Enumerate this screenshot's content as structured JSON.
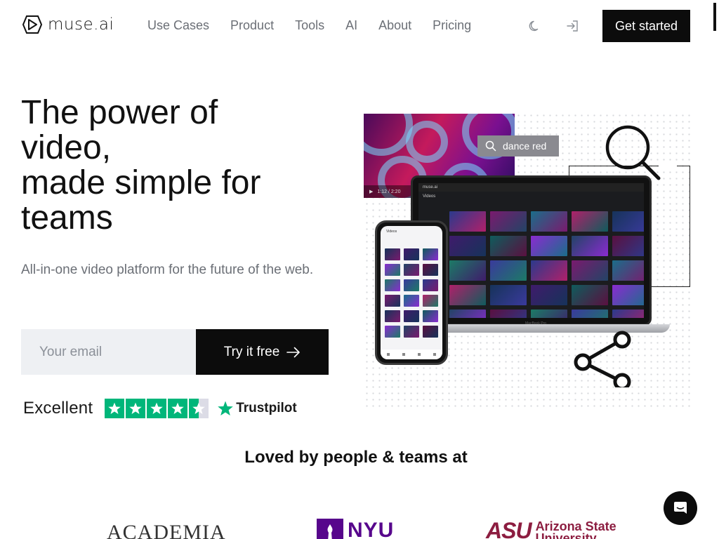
{
  "brand": {
    "name": "muse.ai",
    "icon": "play-hexagon-icon"
  },
  "nav": {
    "items": [
      "Use Cases",
      "Product",
      "Tools",
      "AI",
      "About",
      "Pricing"
    ],
    "theme_icon": "moon-icon",
    "login_icon": "sign-in-icon",
    "cta": "Get started"
  },
  "hero": {
    "title_lines": [
      "The power of",
      "video,",
      "made simple for",
      "teams"
    ],
    "subtitle": "All-in-one video platform for the future of the web.",
    "email_placeholder": "Your email",
    "cta": "Try it free",
    "cta_icon": "arrow-right-icon"
  },
  "trustpilot": {
    "rating_word": "Excellent",
    "stars": 4.5,
    "brand": "Trustpilot",
    "star_color": "#00b67a"
  },
  "illustration": {
    "search_query": "dance red",
    "video_time": "1:12 / 2:20",
    "app_name": "muse.ai",
    "section_label": "Videos",
    "laptop_label": "MacBook Pro"
  },
  "logos": {
    "heading": "Loved by people & teams at",
    "items": [
      "ACADEMIA",
      "NYU",
      "Arizona State University"
    ],
    "asu_mark": "ASU",
    "asu_lines": [
      "Arizona State",
      "University"
    ]
  },
  "colors": {
    "accent": "#0c0c0c",
    "nav_text": "#6b6f76",
    "nyu_purple": "#57068c",
    "asu_maroon": "#8c1d40"
  },
  "chat": {
    "icon": "chat-bubble-icon"
  }
}
